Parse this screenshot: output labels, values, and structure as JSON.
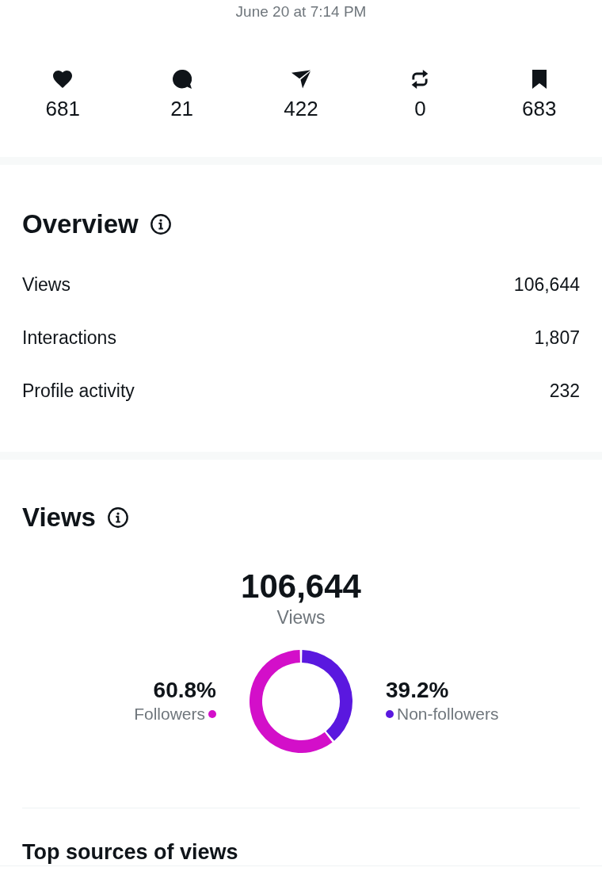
{
  "timestamp": "June 20 at 7:14 PM",
  "stats": [
    {
      "kind": "like",
      "count": "681"
    },
    {
      "kind": "reply",
      "count": "21"
    },
    {
      "kind": "share",
      "count": "422"
    },
    {
      "kind": "repost",
      "count": "0"
    },
    {
      "kind": "bookmark",
      "count": "683"
    }
  ],
  "overview": {
    "title": "Overview",
    "rows": [
      {
        "label": "Views",
        "value": "106,644"
      },
      {
        "label": "Interactions",
        "value": "1,807"
      },
      {
        "label": "Profile activity",
        "value": "232"
      }
    ]
  },
  "views": {
    "title": "Views",
    "total": "106,644",
    "total_label": "Views",
    "chart_data": {
      "type": "donut",
      "categories": [
        "Followers",
        "Non-followers"
      ],
      "values": [
        60.8,
        39.2
      ],
      "value_labels": [
        "60.8%",
        "39.2%"
      ]
    },
    "legend": [
      {
        "color": "#d30fc9"
      },
      {
        "color": "#5a18df"
      }
    ]
  },
  "top_sources": {
    "title": "Top sources of views"
  }
}
